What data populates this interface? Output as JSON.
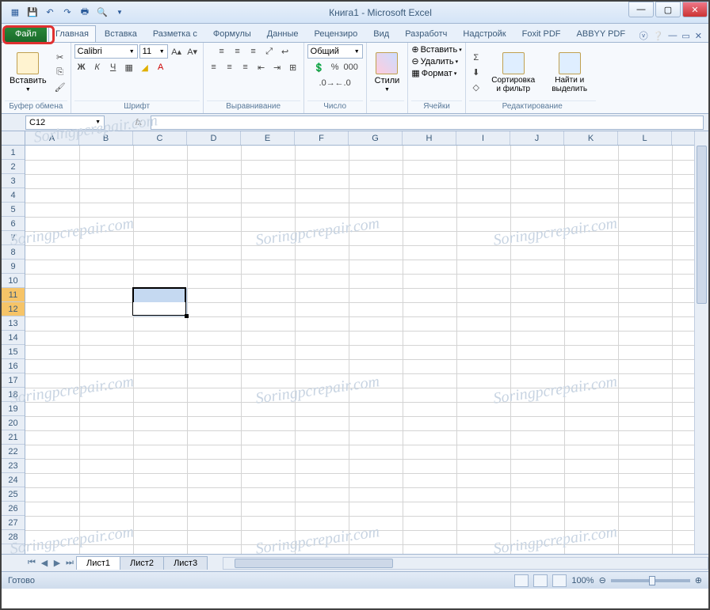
{
  "title": "Книга1 - Microsoft Excel",
  "qat_icons": [
    "excel-icon",
    "save-icon",
    "undo-icon",
    "redo-icon",
    "print-icon",
    "preview-icon"
  ],
  "win_controls": [
    "minimize",
    "maximize",
    "close"
  ],
  "tabs": {
    "file": "Файл",
    "items": [
      "Главная",
      "Вставка",
      "Разметка с",
      "Формулы",
      "Данные",
      "Рецензиро",
      "Вид",
      "Разработч",
      "Надстройк",
      "Foxit PDF",
      "ABBYY PDF"
    ]
  },
  "ribbon": {
    "clipboard": {
      "paste": "Вставить",
      "label": "Буфер обмена"
    },
    "font": {
      "name": "Calibri",
      "size": "11",
      "label": "Шрифт",
      "btns": [
        "Ж",
        "К",
        "Ч"
      ]
    },
    "align": {
      "label": "Выравнивание"
    },
    "number": {
      "format": "Общий",
      "label": "Число"
    },
    "styles": {
      "btn": "Стили",
      "label": ""
    },
    "cells": {
      "insert": "Вставить",
      "delete": "Удалить",
      "format": "Формат",
      "label": "Ячейки"
    },
    "editing": {
      "sort": "Сортировка и фильтр",
      "find": "Найти и выделить",
      "label": "Редактирование"
    }
  },
  "namebox": "C12",
  "fx": "fx",
  "columns": [
    "A",
    "B",
    "C",
    "D",
    "E",
    "F",
    "G",
    "H",
    "I",
    "J",
    "K",
    "L"
  ],
  "rows": [
    "1",
    "2",
    "3",
    "4",
    "5",
    "6",
    "7",
    "8",
    "9",
    "10",
    "11",
    "12",
    "13",
    "14",
    "15",
    "16",
    "17",
    "18",
    "19",
    "20",
    "21",
    "22",
    "23",
    "24",
    "25",
    "26",
    "27",
    "28"
  ],
  "selected_rows": [
    11,
    12
  ],
  "selection": {
    "col": 2,
    "row_from": 10,
    "row_to": 11
  },
  "active_cell": {
    "col": 2,
    "row": 11
  },
  "sheets": [
    "Лист1",
    "Лист2",
    "Лист3"
  ],
  "active_sheet": 0,
  "status": "Готово",
  "zoom": "100%",
  "watermark": "Soringpcrepair.com"
}
